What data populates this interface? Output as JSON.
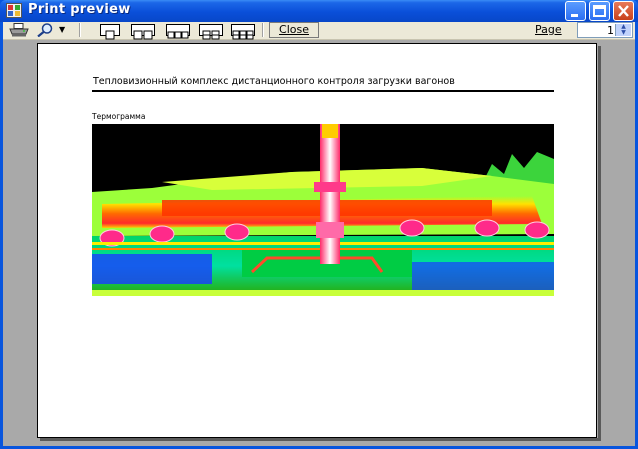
{
  "window": {
    "title": "Print preview"
  },
  "toolbar": {
    "print_icon": "printer-icon",
    "zoom_icon": "magnifier-icon",
    "page_layouts": [
      "one-page-icon",
      "two-pages-icon",
      "three-pages-icon",
      "four-pages-icon",
      "six-pages-icon"
    ],
    "close_label": "Close",
    "page_label": "Page",
    "page_value": "1"
  },
  "document": {
    "title": "Тепловизионный комплекс дистанционного контроля загрузки вагонов",
    "section_label": "Термограмма",
    "image_icon": "thermogram-image"
  },
  "colors": {
    "titlebar": "#0a4fd9",
    "toolbar": "#ece9d8",
    "preview_bg": "#a9a9a9"
  }
}
